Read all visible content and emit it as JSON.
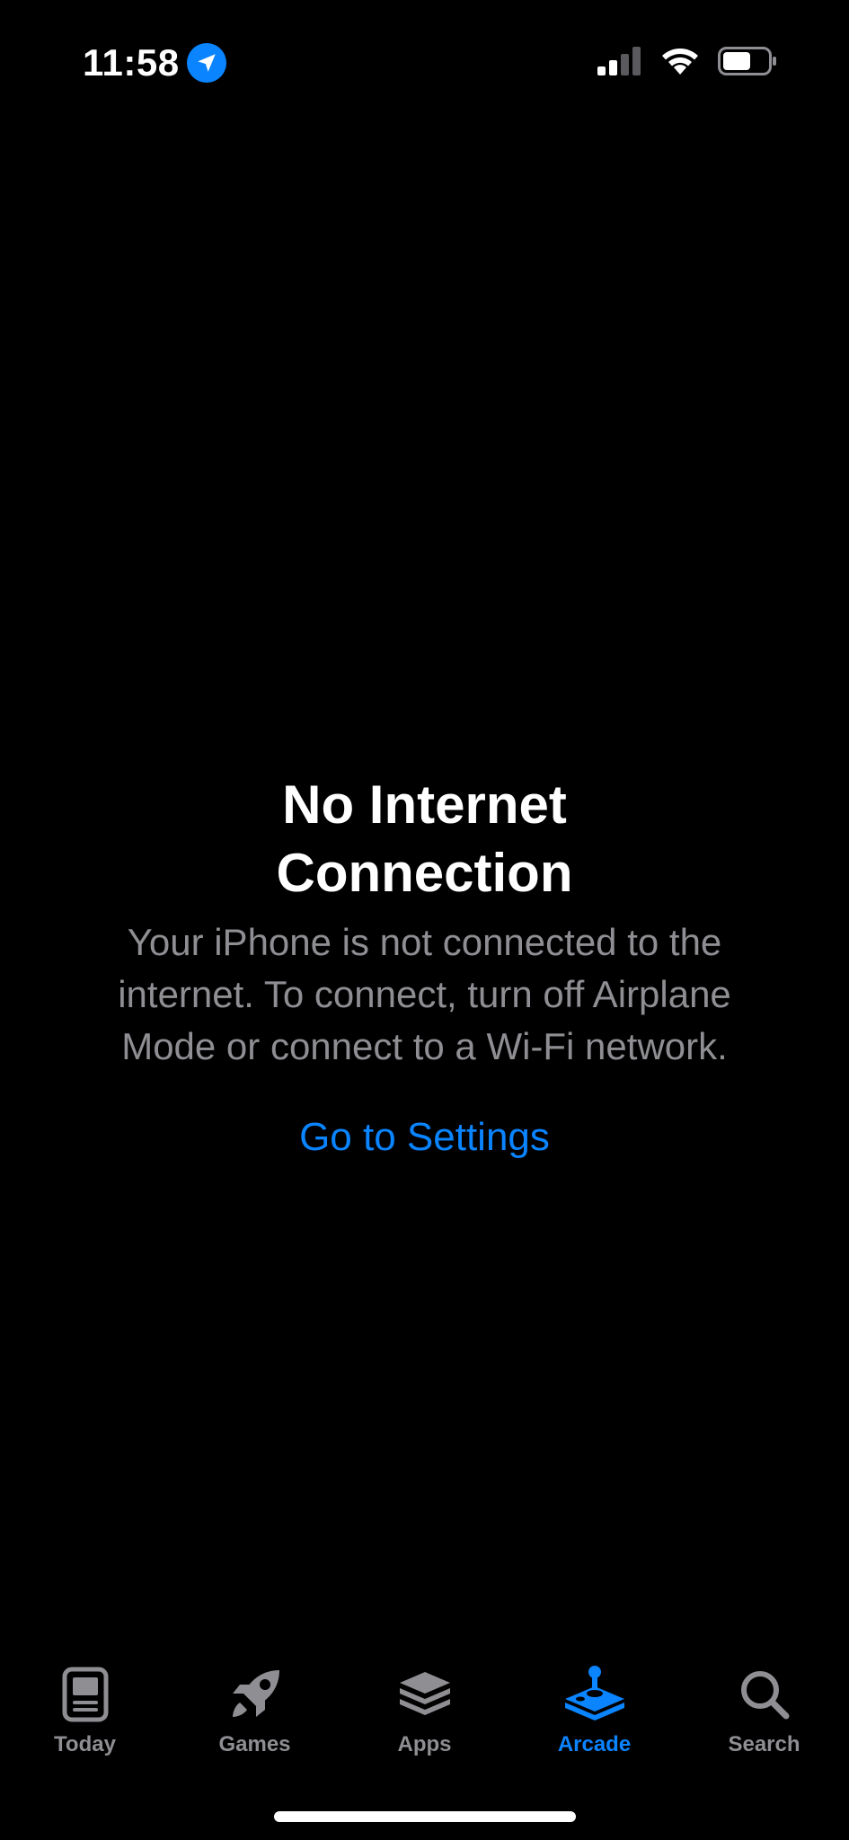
{
  "status_bar": {
    "time": "11:58",
    "icons": [
      "location-arrow-icon",
      "cellular-signal-icon",
      "wifi-icon",
      "battery-icon"
    ]
  },
  "message": {
    "title": "No Internet Connection",
    "body": "Your iPhone is not connected to the internet. To connect, turn off Airplane Mode or connect to a Wi-Fi network.",
    "link_label": "Go to Settings"
  },
  "tab_bar": {
    "tabs": [
      {
        "label": "Today",
        "icon": "today-icon",
        "active": false
      },
      {
        "label": "Games",
        "icon": "rocket-icon",
        "active": false
      },
      {
        "label": "Apps",
        "icon": "apps-stack-icon",
        "active": false
      },
      {
        "label": "Arcade",
        "icon": "joystick-icon",
        "active": true
      },
      {
        "label": "Search",
        "icon": "search-icon",
        "active": false
      }
    ]
  },
  "colors": {
    "background": "#000000",
    "accent": "#0a84ff",
    "secondary_text": "#8e8e93",
    "primary_text": "#ffffff"
  }
}
